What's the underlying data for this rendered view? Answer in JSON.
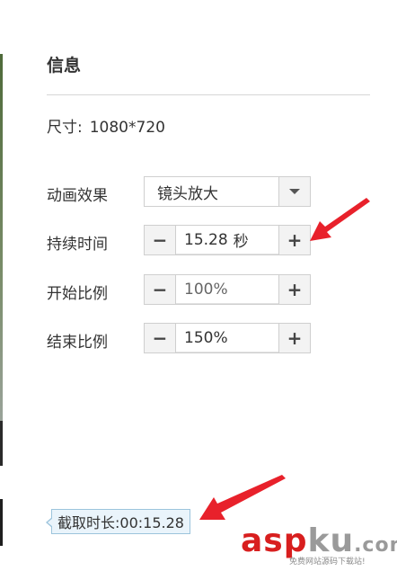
{
  "panel": {
    "title": "信息"
  },
  "size": {
    "label": "尺寸:",
    "value": "1080*720"
  },
  "animation": {
    "label": "动画效果",
    "value": "镜头放大"
  },
  "duration": {
    "label": "持续时间",
    "value": "15.28",
    "unit": "秒"
  },
  "start_scale": {
    "label": "开始比例",
    "value": "100%"
  },
  "end_scale": {
    "label": "结束比例",
    "value": "150%"
  },
  "stepper": {
    "minus": "−",
    "plus": "+"
  },
  "clip": {
    "text": "截取时长:00:15.28"
  },
  "watermark": {
    "brand_a": "asp",
    "brand_b": "ku",
    "brand_c": ".com",
    "sub": "免费网站源码下载站!"
  },
  "colors": {
    "arrow": "#e8212b",
    "tooltip_bg": "#eaf4fb",
    "watermark_red": "#d81e1e"
  }
}
